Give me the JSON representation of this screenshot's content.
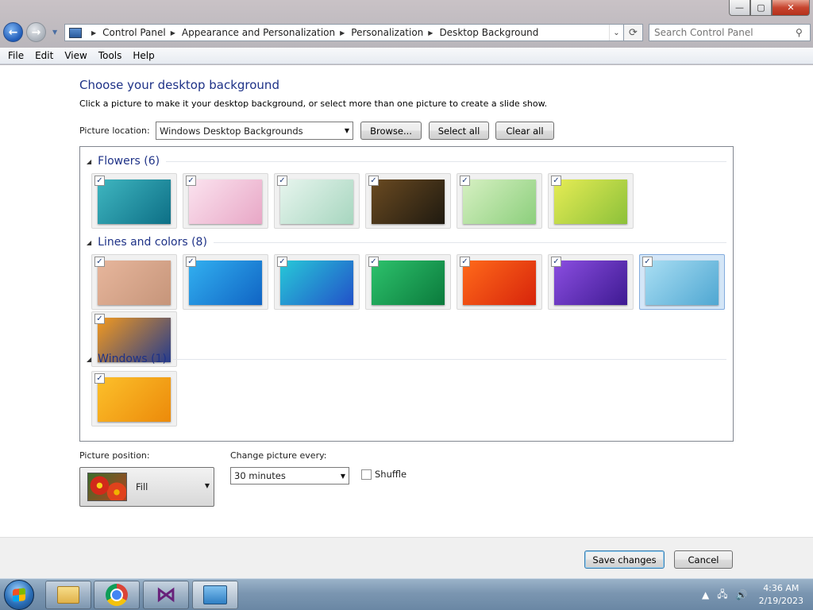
{
  "window": {
    "caption": {
      "minimize": "—",
      "maximize": "▢",
      "close": "✕"
    }
  },
  "navbar": {
    "back_glyph": "←",
    "forward_glyph": "→",
    "recent_glyph": "▼",
    "breadcrumbs": [
      "Control Panel",
      "Appearance and Personalization",
      "Personalization",
      "Desktop Background"
    ],
    "crumb_sep": "▶",
    "dropdown_glyph": "⌄",
    "refresh_glyph": "⟳",
    "search_placeholder": "Search Control Panel",
    "search_glyph": "⚲"
  },
  "menu": [
    "File",
    "Edit",
    "View",
    "Tools",
    "Help"
  ],
  "page": {
    "title": "Choose your desktop background",
    "subtitle": "Click a picture to make it your desktop background, or select more than one picture to create a slide show.",
    "location_label": "Picture location:",
    "location_value": "Windows Desktop Backgrounds",
    "browse": "Browse...",
    "select_all": "Select all",
    "clear_all": "Clear all",
    "check_glyph": "✓",
    "collapse_glyph": "◢"
  },
  "groups": [
    {
      "title": "Flowers (6)",
      "items": [
        {
          "name": "flower-red-teal",
          "colors": [
            "#3fb6c0",
            "#0d6f86"
          ],
          "checked": true,
          "selected": false
        },
        {
          "name": "flower-orange-pink",
          "colors": [
            "#fbe3ef",
            "#e8a7c6"
          ],
          "checked": true,
          "selected": false
        },
        {
          "name": "flower-pink-mint",
          "colors": [
            "#e7f5ee",
            "#a7d6bf"
          ],
          "checked": true,
          "selected": false
        },
        {
          "name": "flower-red-dark",
          "colors": [
            "#6a4a21",
            "#1f1a10"
          ],
          "checked": true,
          "selected": false
        },
        {
          "name": "flower-pink-green",
          "colors": [
            "#d6f0c2",
            "#8ccf7c"
          ],
          "checked": true,
          "selected": false
        },
        {
          "name": "leaf-yellow-green",
          "colors": [
            "#e6ec54",
            "#8cc13a"
          ],
          "checked": true,
          "selected": false
        }
      ]
    },
    {
      "title": "Lines and colors (8)",
      "items": [
        {
          "name": "cartoon-character",
          "colors": [
            "#e7b69c",
            "#c6957a"
          ],
          "checked": true,
          "selected": false
        },
        {
          "name": "blue-lines",
          "colors": [
            "#32b0f0",
            "#1064c4"
          ],
          "checked": true,
          "selected": false
        },
        {
          "name": "blue-facets",
          "colors": [
            "#27c9d8",
            "#2251c9"
          ],
          "checked": true,
          "selected": false
        },
        {
          "name": "green-stripes",
          "colors": [
            "#2dc26c",
            "#0b7a3c"
          ],
          "checked": true,
          "selected": false
        },
        {
          "name": "orange-waves",
          "colors": [
            "#ff6a1a",
            "#d7240b"
          ],
          "checked": true,
          "selected": false
        },
        {
          "name": "purple-waves",
          "colors": [
            "#8b4ee1",
            "#3e1a92"
          ],
          "checked": true,
          "selected": false
        },
        {
          "name": "light-blue-stripes",
          "colors": [
            "#a9def3",
            "#4fa7d2"
          ],
          "checked": true,
          "selected": true
        },
        {
          "name": "orange-bars",
          "colors": [
            "#f39a1f",
            "#263c8c"
          ],
          "checked": true,
          "selected": false
        }
      ]
    },
    {
      "title": "Windows (1)",
      "items": [
        {
          "name": "windows-yellow",
          "colors": [
            "#fcc02b",
            "#ec8a0a"
          ],
          "checked": true,
          "selected": false
        }
      ]
    }
  ],
  "position": {
    "label": "Picture position:",
    "value": "Fill"
  },
  "interval": {
    "label": "Change picture every:",
    "value": "30 minutes"
  },
  "shuffle": {
    "label": "Shuffle",
    "checked": false
  },
  "footer": {
    "save": "Save changes",
    "cancel": "Cancel"
  },
  "taskbar": {
    "tray_up": "▲",
    "network_glyph": "🖧",
    "volume_glyph": "🔊",
    "time": "4:36 AM",
    "date": "2/19/2023"
  }
}
